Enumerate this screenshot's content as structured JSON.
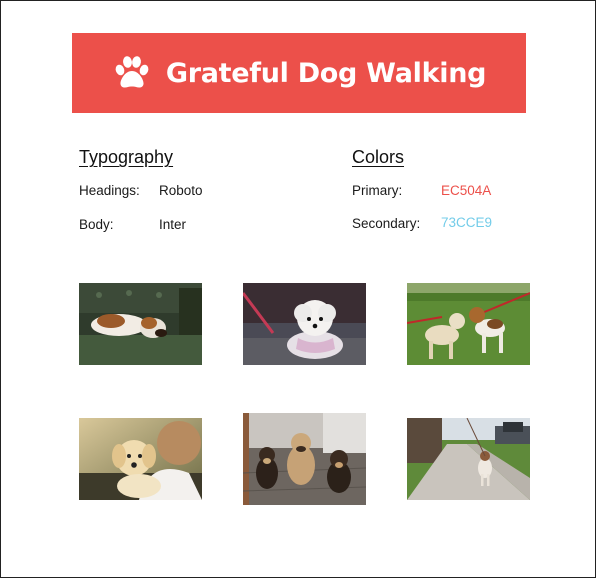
{
  "header": {
    "title": "Grateful Dog Walking",
    "icon": "paw-icon",
    "background": "#EC504A"
  },
  "typography": {
    "title": "Typography",
    "rows": [
      {
        "label": "Headings:",
        "value": "Roboto"
      },
      {
        "label": "Body:",
        "value": "Inter"
      }
    ]
  },
  "colors": {
    "title": "Colors",
    "rows": [
      {
        "label": "Primary:",
        "value": "EC504A",
        "hex": "#EC504A"
      },
      {
        "label": "Secondary:",
        "value": "73CCE9",
        "hex": "#73CCE9"
      }
    ]
  },
  "gallery": {
    "photos": [
      {
        "name": "beagle-sleeping-on-couch-photo"
      },
      {
        "name": "white-poodle-on-leash-photo"
      },
      {
        "name": "two-dogs-on-grass-photo"
      },
      {
        "name": "puppy-on-shoulder-photo"
      },
      {
        "name": "three-small-dogs-photo"
      },
      {
        "name": "dog-on-sidewalk-photo"
      }
    ]
  }
}
